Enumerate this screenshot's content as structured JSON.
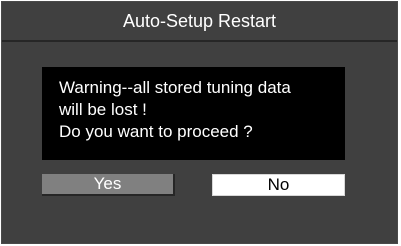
{
  "dialog": {
    "title": "Auto-Setup Restart",
    "message_lines": [
      "Warning--all stored tuning data",
      "will be lost !",
      "Do you want to proceed ?"
    ],
    "buttons": {
      "yes_label": "Yes",
      "no_label": "No"
    }
  },
  "colors": {
    "background": "#404040",
    "message_box": "#000000",
    "yes_button": "#808080",
    "no_button": "#ffffff",
    "text": "#ffffff"
  }
}
